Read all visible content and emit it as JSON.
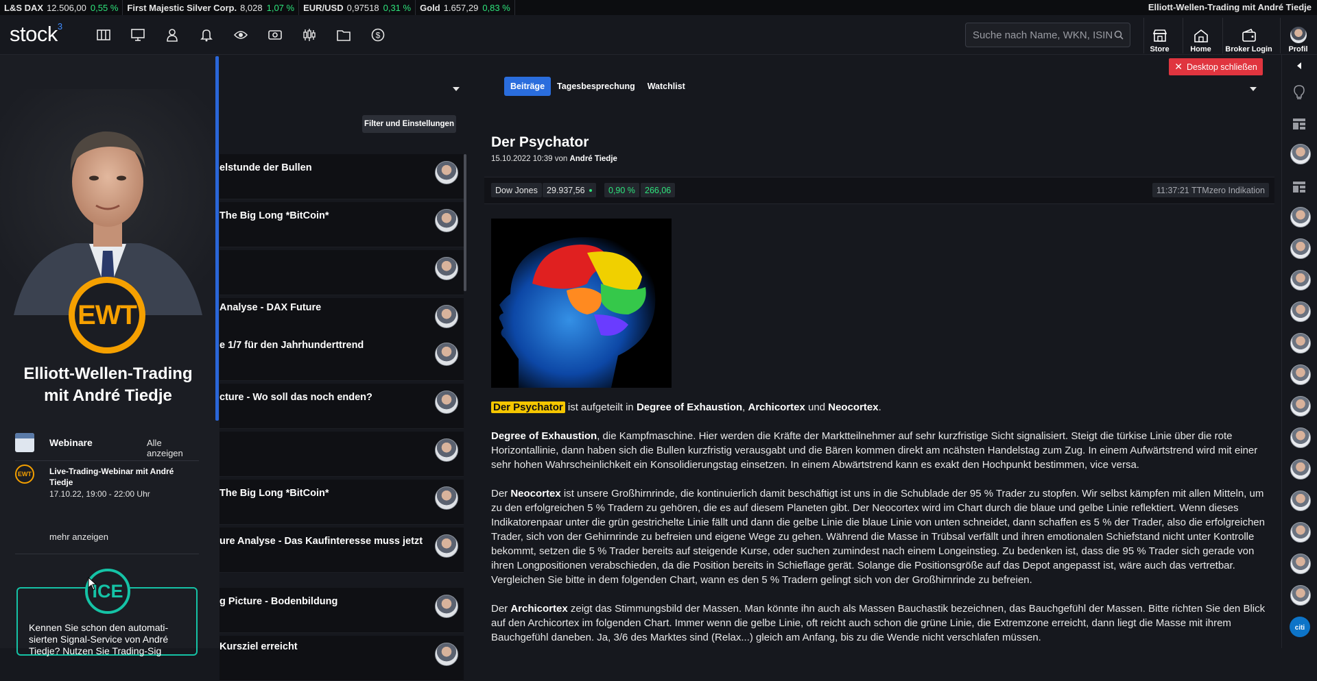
{
  "ticker": {
    "items": [
      {
        "name": "L&S DAX",
        "value": "12.506,00",
        "change": "0,55 %"
      },
      {
        "name": "First Majestic Silver Corp.",
        "value": "8,028",
        "change": "1,07 %"
      },
      {
        "name": "EUR/USD",
        "value": "0,97518",
        "change": "0,31 %"
      },
      {
        "name": "Gold",
        "value": "1.657,29",
        "change": "0,83 %"
      }
    ],
    "right_title": "Elliott-Wellen-Trading mit André Tiedje"
  },
  "header": {
    "logo": "stock",
    "logo_sup": "3",
    "search_placeholder": "Suche nach Name, WKN, ISIN",
    "buttons": {
      "store": "Store",
      "home": "Home",
      "broker": "Broker Login",
      "profil": "Profil"
    },
    "close_desktop": "Desktop schließen"
  },
  "left_panel": {
    "logo_text": "EWT",
    "title_line1": "Elliott-Wellen-Trading",
    "title_line2": "mit André Tiedje",
    "webinare_label": "Webinare",
    "alle_anzeigen": "Alle anzeigen",
    "webinar_logo": "EWT",
    "webinar_title": "Live-Trading-Webinar mit André Tiedje",
    "webinar_time": "17.10.22, 19:00 - 22:00 Uhr",
    "mehr_anzeigen": "mehr anzeigen",
    "ice_logo": "ICE",
    "ice_text": "Kennen Sie schon den automati­sierten Signal-Service von André Tiedje? Nutzen Sie Trading-Sig"
  },
  "list": {
    "filter_button": "Filter und Einstellungen",
    "items": [
      {
        "title": "elstunde der Bullen"
      },
      {
        "title": "The Big Long *BitCoin*"
      },
      {
        "title": ""
      },
      {
        "title": "Analyse - DAX Future"
      },
      {
        "title": "e 1/7 für den Jahrhunderttrend"
      },
      {
        "title": "cture - Wo soll das noch enden?"
      },
      {
        "title": ""
      },
      {
        "title": "The Big Long *BitCoin*"
      },
      {
        "title": "ure Analyse - Das Kaufinteresse muss jetzt"
      },
      {
        "title": "g Picture - Bodenbildung"
      },
      {
        "title": "Kursziel erreicht"
      }
    ]
  },
  "tabs": [
    {
      "label": "Beiträge",
      "active": true
    },
    {
      "label": "Tagesbesprechung",
      "active": false
    },
    {
      "label": "Watchlist",
      "active": false
    }
  ],
  "article": {
    "title": "Der Psychator",
    "date": "15.10.2022 10:39 von ",
    "author": "André Tiedje",
    "quote": {
      "name": "Dow Jones",
      "price": "29.937,56",
      "change_pct": "0,90 %",
      "change_abs": "266,06",
      "time_note": "11:37:21 TTMzero Indikation"
    },
    "p1_hl": "Der Psychator",
    "p1_a": " ist aufgeteilt in ",
    "p1_b1": "Degree of Exhaustion",
    "p1_c": ", ",
    "p1_b2": "Archicortex",
    "p1_d": " und ",
    "p1_b3": "Neocortex",
    "p1_e": ".",
    "p2_b": "Degree of Exhaustion",
    "p2_text": ", die Kampfmaschine. Hier werden die Kräfte der Marktteilnehmer auf sehr kurzfristige Sicht signalisiert. Steigt die türkise Linie über die rote Horizontallinie, dann haben sich die Bullen kurzfristig verausgabt und die Bären kommen direkt am ncähsten Handelstag zum Zug. In einem Aufwärtstrend wird mit einer sehr hohen Wahrscheinlichkeit ein Konsolidierungstag einsetzen. In einem Abwärtstrend kann es exakt den Hochpunkt bestimmen, vice versa.",
    "p3_a": "Der ",
    "p3_b": "Neocortex",
    "p3_text": " ist unsere Großhirnrinde, die kontinuierlich damit beschäftigt ist uns in die Schublade der 95 % Trader zu stopfen. Wir selbst kämpfen mit allen Mitteln, um zu den erfolgreichen 5 % Tradern zu gehören, die es auf diesem Planeten gibt. Der Neocortex wird im Chart durch die blaue und gelbe Linie reflek­tiert. Wenn dieses Indikatorenpaar unter die grün gestrichelte Linie fällt und dann die gelbe Linie die blaue Linie von unten schneidet, dann schaffen es 5 % der Trader, also die erfolgreichen Trader, sich von der Gehirnrinde zu befreien und eigene Wege zu gehen. Während die Masse in Trübsal verfällt und ihren emotiona­len Schiefstand nicht unter Kontrolle bekommt, setzen die 5 % Trader bereits auf steigende Kurse, oder suchen zumindest nach einem Longeinstieg. Zu bedenken ist, dass die 95 % Trader sich gerade von ihren Longpositionen verabschieden, da die Position bereits in Schieflage gerät. Solange die Positionsgröße auf das De­pot angepasst ist, wäre auch das vertretbar. Vergleichen Sie bitte in dem folgenden Chart, wann es den 5 % Tradern gelingt sich von der Großhirnrinde zu befreien.",
    "p4_a": "Der ",
    "p4_b": "Archicortex",
    "p4_text": " zeigt das Stimmungsbild der Massen. Man könnte ihn auch als Massen Bauchastik bezeichnen, das Bauchgefühl der Massen. Bitte richten Sie den Blick auf den Archicortex im folgenden Chart. Immer wenn die gelbe Linie, oft reicht auch schon die grüne Linie, die Extremzone erreicht, dann liegt die Masse mit ihrem Bauchgefühl daneben. Ja, 3/6 des Marktes sind (Relax...) gleich am Anfang, bis zu die Wende nicht verschlafen müssen."
  },
  "colors": {
    "accent": "#2a6ddd",
    "positive": "#2ee57c",
    "danger": "#e0353f",
    "ewt_orange": "#f5a000",
    "ice_teal": "#15c3a6",
    "highlight": "#f5c600"
  }
}
